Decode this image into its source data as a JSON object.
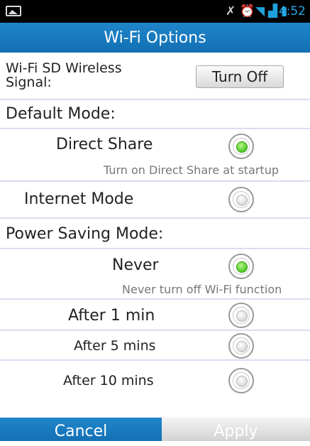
{
  "status_bar": {
    "time": "4:52",
    "icons": [
      "image-icon",
      "mute-icon",
      "alarm-icon",
      "wifi-icon",
      "signal-icon",
      "battery-icon"
    ]
  },
  "title": "Wi-Fi Options",
  "wireless_signal": {
    "label": "Wi-Fi SD Wireless Signal:",
    "button": "Turn Off"
  },
  "default_mode": {
    "heading": "Default Mode:",
    "options": [
      {
        "label": "Direct Share",
        "selected": true,
        "description": "Turn on Direct Share at startup"
      },
      {
        "label": "Internet Mode",
        "selected": false
      }
    ]
  },
  "power_saving": {
    "heading": "Power Saving Mode:",
    "options": [
      {
        "label": "Never",
        "selected": true,
        "description": "Never turn off Wi-Fi function"
      },
      {
        "label": "After 1 min",
        "selected": false
      },
      {
        "label": "After 5 mins",
        "selected": false
      },
      {
        "label": "After 10 mins",
        "selected": false
      }
    ]
  },
  "footer": {
    "cancel": "Cancel",
    "apply": "Apply"
  },
  "colors": {
    "accent": "#1b7fc3",
    "radio_selected": "#4fca22",
    "divider": "#dcdcf0"
  }
}
